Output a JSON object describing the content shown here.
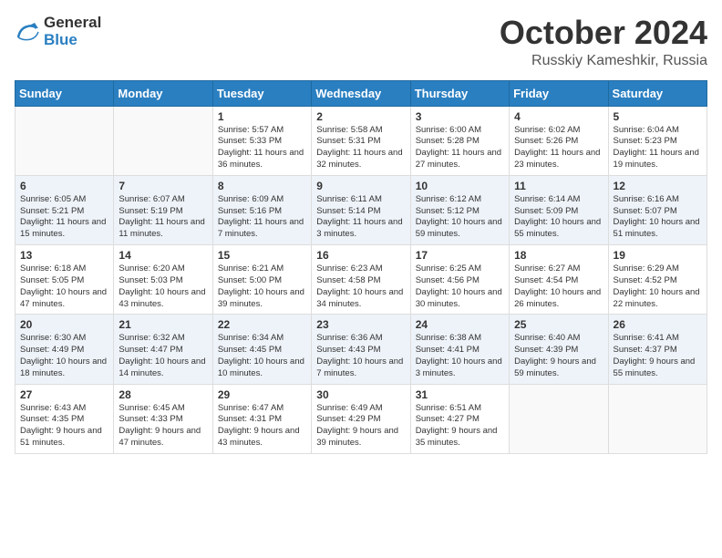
{
  "header": {
    "logo_general": "General",
    "logo_blue": "Blue",
    "month_title": "October 2024",
    "location": "Russkiy Kameshkir, Russia"
  },
  "weekdays": [
    "Sunday",
    "Monday",
    "Tuesday",
    "Wednesday",
    "Thursday",
    "Friday",
    "Saturday"
  ],
  "weeks": [
    [
      {
        "day": "",
        "sunrise": "",
        "sunset": "",
        "daylight": ""
      },
      {
        "day": "",
        "sunrise": "",
        "sunset": "",
        "daylight": ""
      },
      {
        "day": "1",
        "sunrise": "Sunrise: 5:57 AM",
        "sunset": "Sunset: 5:33 PM",
        "daylight": "Daylight: 11 hours and 36 minutes."
      },
      {
        "day": "2",
        "sunrise": "Sunrise: 5:58 AM",
        "sunset": "Sunset: 5:31 PM",
        "daylight": "Daylight: 11 hours and 32 minutes."
      },
      {
        "day": "3",
        "sunrise": "Sunrise: 6:00 AM",
        "sunset": "Sunset: 5:28 PM",
        "daylight": "Daylight: 11 hours and 27 minutes."
      },
      {
        "day": "4",
        "sunrise": "Sunrise: 6:02 AM",
        "sunset": "Sunset: 5:26 PM",
        "daylight": "Daylight: 11 hours and 23 minutes."
      },
      {
        "day": "5",
        "sunrise": "Sunrise: 6:04 AM",
        "sunset": "Sunset: 5:23 PM",
        "daylight": "Daylight: 11 hours and 19 minutes."
      }
    ],
    [
      {
        "day": "6",
        "sunrise": "Sunrise: 6:05 AM",
        "sunset": "Sunset: 5:21 PM",
        "daylight": "Daylight: 11 hours and 15 minutes."
      },
      {
        "day": "7",
        "sunrise": "Sunrise: 6:07 AM",
        "sunset": "Sunset: 5:19 PM",
        "daylight": "Daylight: 11 hours and 11 minutes."
      },
      {
        "day": "8",
        "sunrise": "Sunrise: 6:09 AM",
        "sunset": "Sunset: 5:16 PM",
        "daylight": "Daylight: 11 hours and 7 minutes."
      },
      {
        "day": "9",
        "sunrise": "Sunrise: 6:11 AM",
        "sunset": "Sunset: 5:14 PM",
        "daylight": "Daylight: 11 hours and 3 minutes."
      },
      {
        "day": "10",
        "sunrise": "Sunrise: 6:12 AM",
        "sunset": "Sunset: 5:12 PM",
        "daylight": "Daylight: 10 hours and 59 minutes."
      },
      {
        "day": "11",
        "sunrise": "Sunrise: 6:14 AM",
        "sunset": "Sunset: 5:09 PM",
        "daylight": "Daylight: 10 hours and 55 minutes."
      },
      {
        "day": "12",
        "sunrise": "Sunrise: 6:16 AM",
        "sunset": "Sunset: 5:07 PM",
        "daylight": "Daylight: 10 hours and 51 minutes."
      }
    ],
    [
      {
        "day": "13",
        "sunrise": "Sunrise: 6:18 AM",
        "sunset": "Sunset: 5:05 PM",
        "daylight": "Daylight: 10 hours and 47 minutes."
      },
      {
        "day": "14",
        "sunrise": "Sunrise: 6:20 AM",
        "sunset": "Sunset: 5:03 PM",
        "daylight": "Daylight: 10 hours and 43 minutes."
      },
      {
        "day": "15",
        "sunrise": "Sunrise: 6:21 AM",
        "sunset": "Sunset: 5:00 PM",
        "daylight": "Daylight: 10 hours and 39 minutes."
      },
      {
        "day": "16",
        "sunrise": "Sunrise: 6:23 AM",
        "sunset": "Sunset: 4:58 PM",
        "daylight": "Daylight: 10 hours and 34 minutes."
      },
      {
        "day": "17",
        "sunrise": "Sunrise: 6:25 AM",
        "sunset": "Sunset: 4:56 PM",
        "daylight": "Daylight: 10 hours and 30 minutes."
      },
      {
        "day": "18",
        "sunrise": "Sunrise: 6:27 AM",
        "sunset": "Sunset: 4:54 PM",
        "daylight": "Daylight: 10 hours and 26 minutes."
      },
      {
        "day": "19",
        "sunrise": "Sunrise: 6:29 AM",
        "sunset": "Sunset: 4:52 PM",
        "daylight": "Daylight: 10 hours and 22 minutes."
      }
    ],
    [
      {
        "day": "20",
        "sunrise": "Sunrise: 6:30 AM",
        "sunset": "Sunset: 4:49 PM",
        "daylight": "Daylight: 10 hours and 18 minutes."
      },
      {
        "day": "21",
        "sunrise": "Sunrise: 6:32 AM",
        "sunset": "Sunset: 4:47 PM",
        "daylight": "Daylight: 10 hours and 14 minutes."
      },
      {
        "day": "22",
        "sunrise": "Sunrise: 6:34 AM",
        "sunset": "Sunset: 4:45 PM",
        "daylight": "Daylight: 10 hours and 10 minutes."
      },
      {
        "day": "23",
        "sunrise": "Sunrise: 6:36 AM",
        "sunset": "Sunset: 4:43 PM",
        "daylight": "Daylight: 10 hours and 7 minutes."
      },
      {
        "day": "24",
        "sunrise": "Sunrise: 6:38 AM",
        "sunset": "Sunset: 4:41 PM",
        "daylight": "Daylight: 10 hours and 3 minutes."
      },
      {
        "day": "25",
        "sunrise": "Sunrise: 6:40 AM",
        "sunset": "Sunset: 4:39 PM",
        "daylight": "Daylight: 9 hours and 59 minutes."
      },
      {
        "day": "26",
        "sunrise": "Sunrise: 6:41 AM",
        "sunset": "Sunset: 4:37 PM",
        "daylight": "Daylight: 9 hours and 55 minutes."
      }
    ],
    [
      {
        "day": "27",
        "sunrise": "Sunrise: 6:43 AM",
        "sunset": "Sunset: 4:35 PM",
        "daylight": "Daylight: 9 hours and 51 minutes."
      },
      {
        "day": "28",
        "sunrise": "Sunrise: 6:45 AM",
        "sunset": "Sunset: 4:33 PM",
        "daylight": "Daylight: 9 hours and 47 minutes."
      },
      {
        "day": "29",
        "sunrise": "Sunrise: 6:47 AM",
        "sunset": "Sunset: 4:31 PM",
        "daylight": "Daylight: 9 hours and 43 minutes."
      },
      {
        "day": "30",
        "sunrise": "Sunrise: 6:49 AM",
        "sunset": "Sunset: 4:29 PM",
        "daylight": "Daylight: 9 hours and 39 minutes."
      },
      {
        "day": "31",
        "sunrise": "Sunrise: 6:51 AM",
        "sunset": "Sunset: 4:27 PM",
        "daylight": "Daylight: 9 hours and 35 minutes."
      },
      {
        "day": "",
        "sunrise": "",
        "sunset": "",
        "daylight": ""
      },
      {
        "day": "",
        "sunrise": "",
        "sunset": "",
        "daylight": ""
      }
    ]
  ]
}
